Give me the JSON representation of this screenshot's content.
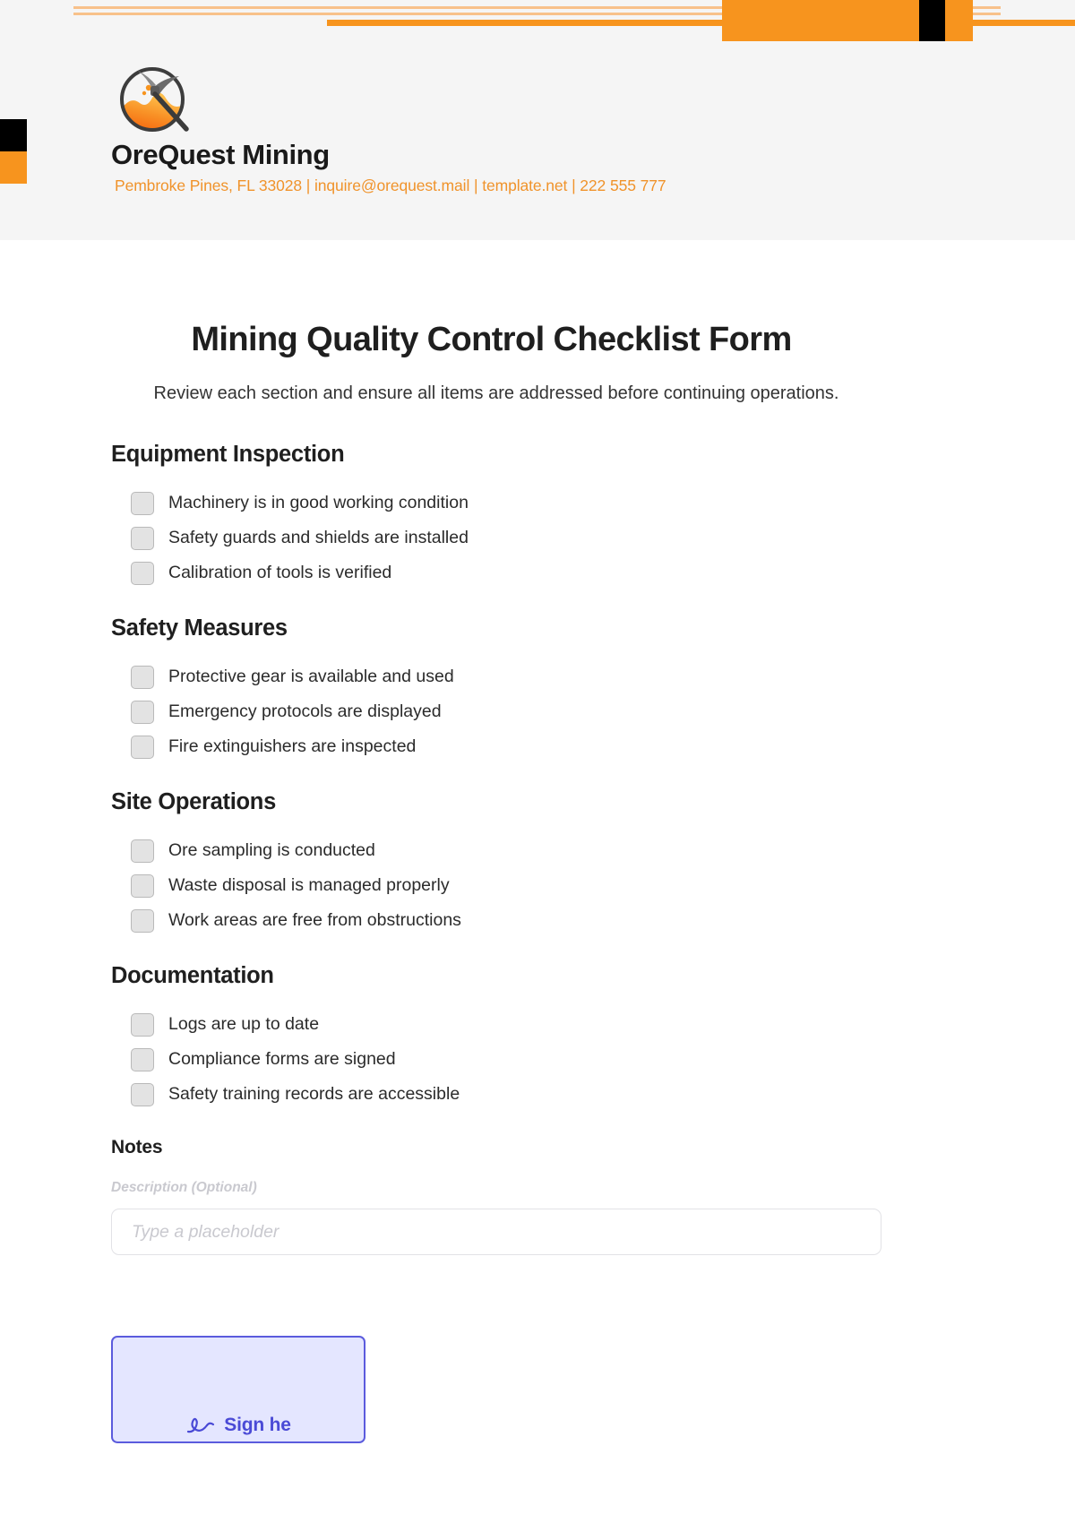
{
  "header": {
    "company_name": "OreQuest Mining",
    "contact_line": "Pembroke Pines, FL 33028 | inquire@orequest.mail | template.net | 222 555 777",
    "logo_icon": "mining-pickaxe-circle-logo",
    "colors": {
      "band_background": "#f5f5f5",
      "accent_orange": "#f7941e",
      "accent_light_orange": "#f8c18a",
      "accent_black": "#000000",
      "contact_text": "#f0932b"
    }
  },
  "document": {
    "title": "Mining Quality Control Checklist Form",
    "subtitle": "Review each section and ensure all items are addressed before continuing operations."
  },
  "sections": [
    {
      "title": "Equipment Inspection",
      "items": [
        "Machinery is in good working condition",
        "Safety guards and shields are installed",
        "Calibration of tools is verified"
      ]
    },
    {
      "title": "Safety Measures",
      "items": [
        "Protective gear is available and used",
        "Emergency protocols are displayed",
        "Fire extinguishers are inspected"
      ]
    },
    {
      "title": "Site Operations",
      "items": [
        "Ore sampling is conducted",
        "Waste disposal is managed properly",
        "Work areas are free from obstructions"
      ]
    },
    {
      "title": "Documentation",
      "items": [
        "Logs are up to date",
        "Compliance forms are signed",
        "Safety training records are accessible"
      ]
    }
  ],
  "notes": {
    "title": "Notes",
    "field_label": "Description (Optional)",
    "input_value": "",
    "input_placeholder": "Type a placeholder"
  },
  "signature": {
    "label": "Sign he",
    "icon": "signature-squiggle-icon",
    "border_color": "#5b5bdd",
    "fill_color": "#e4e6ff"
  }
}
